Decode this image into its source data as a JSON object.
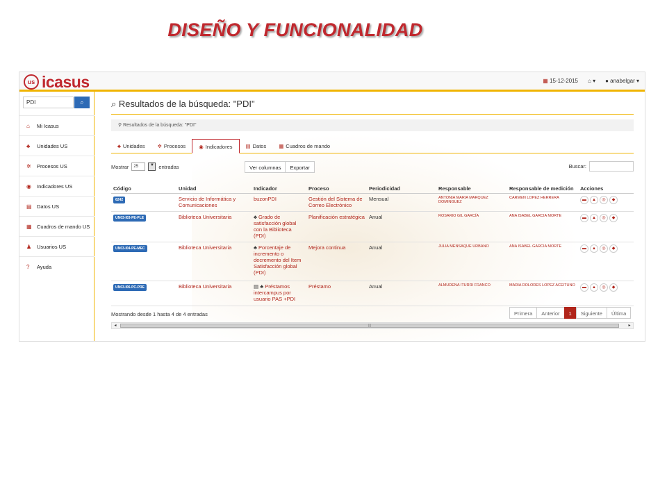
{
  "slide_title": "DISEÑO Y FUNCIONALIDAD",
  "app": {
    "brand": "icasus",
    "logo_text": "us",
    "date": "15-12-2015",
    "user": "anabelgar"
  },
  "sidebar": {
    "search_value": "PDI",
    "items": [
      {
        "label": "Mi Icasus",
        "icon": "home-icon"
      },
      {
        "label": "Unidades US",
        "icon": "sitemap-icon"
      },
      {
        "label": "Procesos US",
        "icon": "cogs-icon"
      },
      {
        "label": "Indicadores US",
        "icon": "dashboard-icon"
      },
      {
        "label": "Datos US",
        "icon": "database-icon"
      },
      {
        "label": "Cuadros de mando US",
        "icon": "grid-icon"
      },
      {
        "label": "Usuarios US",
        "icon": "users-icon"
      },
      {
        "label": "Ayuda",
        "icon": "question-icon"
      }
    ]
  },
  "main": {
    "heading": "Resultados de la búsqueda: \"PDI\"",
    "breadcrumb": "Resultados de la búsqueda: \"PDI\"",
    "tabs": [
      {
        "label": "Unidades"
      },
      {
        "label": "Procesos"
      },
      {
        "label": "Indicadores"
      },
      {
        "label": "Datos"
      },
      {
        "label": "Cuadros de mando"
      }
    ],
    "show_label": "Mostrar",
    "show_value": "25",
    "entries_label": "entradas",
    "columns_button": "Ver columnas",
    "export_button": "Exportar",
    "search_label": "Buscar:",
    "table": {
      "headers": [
        "Código",
        "Unidad",
        "Indicador",
        "Proceso",
        "Periodicidad",
        "Responsable",
        "Responsable de medición",
        "Acciones"
      ],
      "rows": [
        {
          "code": "6242",
          "unit": "Servicio de Informática y Comunicaciones",
          "indicator": "buzonPDI",
          "process": "Gestión del Sistema de Correo Electrónico",
          "period": "Mensual",
          "resp": "ANTONIA MARIA MARQUEZ DOMINGUEZ",
          "resp_med": "CARMEN LOPEZ HERRERA"
        },
        {
          "code": "UN03-I03-PE-PLE",
          "unit": "Biblioteca Universitaria",
          "indicator": "Grado de satisfacción global con la Biblioteca (PDI)",
          "process": "Planificación estratégica",
          "period": "Anual",
          "resp": "ROSARIO GIL GARCÍA",
          "resp_med": "ANA ISABEL GARCIA MORTE"
        },
        {
          "code": "UN03-I04-PE-MEC",
          "unit": "Biblioteca Universitaria",
          "indicator": "Porcentaje de incremento o decremento del Item Satisfacción global (PDI)",
          "process": "Mejora continua",
          "period": "Anual",
          "resp": "JULIA MENSAQUE URBANO",
          "resp_med": "ANA ISABEL GARCIA MORTE"
        },
        {
          "code": "UN03-I06-PC-PRE",
          "unit": "Biblioteca Universitaria",
          "indicator": "Préstamos intercampus por usuario PAS +PDI",
          "process": "Préstamo",
          "period": "Anual",
          "resp": "ALMUDENA ITURRI FRANCO",
          "resp_med": "MARIA DOLORES LOPEZ ACEITUNO"
        }
      ]
    },
    "footer_info": "Mostrando desde 1 hasta 4 de 4 entradas",
    "pager": [
      "Primera",
      "Anterior",
      "1",
      "Siguiente",
      "Última"
    ]
  }
}
